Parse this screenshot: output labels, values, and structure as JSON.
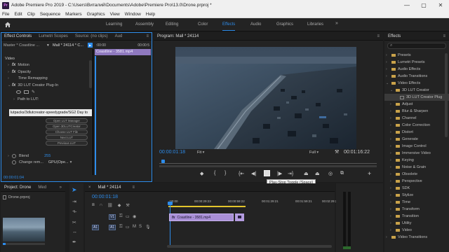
{
  "app": {
    "logo": "Pr",
    "title": "Adobe Premiere Pro 2019 - C:\\Users\\Виталий\\Documents\\Adobe\\Premiere Pro\\13.0\\Drone.prproj *",
    "minimize_glyph": "—",
    "maximize_glyph": "▢",
    "close_glyph": "✕"
  },
  "menu": [
    "File",
    "Edit",
    "Clip",
    "Sequence",
    "Markers",
    "Graphics",
    "View",
    "Window",
    "Help"
  ],
  "workspace": {
    "tabs": [
      "Learning",
      "Assembly",
      "Editing",
      "Color",
      "Effects",
      "Audio",
      "Graphics",
      "Libraries"
    ],
    "active": "Effects",
    "more": "»"
  },
  "left_panel": {
    "tabs": [
      "Effect Controls",
      "Lumetri Scopes",
      "Source: (no clips)",
      "Aud"
    ],
    "menu_glyph": "≡",
    "master_label": "Master * Coastline ...",
    "sequence_label": "Mall * 24114 * C...",
    "ruler_start": ":00:00",
    "ruler_end": "00:00:5",
    "clip_name": "Coastline - 3581.mp4",
    "video_header": "Video",
    "motion": "Motion",
    "opacity": "Opacity",
    "time_remapping": "Time Remapping",
    "plugin_name": "3D LUT Creator Plug-In",
    "path_label": "Path to LUT:",
    "path_value": "lutpacks/3dlutcreator-speedygrade/SG2 Day to",
    "buttons": [
      "Open LUT Manager",
      "Open 3DLUTCreator",
      "Choose LUT File",
      "Next LUT",
      "Previous LUT"
    ],
    "blend_label": "Blend",
    "blend_value": "255",
    "change_label": "Change rem...",
    "change_value": "GPU(Ope...",
    "timecode": "00:00:01:04"
  },
  "program": {
    "tab": "Program: Mall * 24114",
    "menu_glyph": "≡",
    "timecode": "00:00:01:18",
    "fit": "Fit",
    "quality": "Full",
    "duration": "00:01:16:22",
    "tooltip": "Play-Stop Toggle (Space)",
    "controls": {
      "marker": "◆",
      "in": "{",
      "out": "}",
      "go_in": "{⇤",
      "step_back": "◀|",
      "play": "▶",
      "step_fwd": "|▶",
      "go_out": "⇥}",
      "lift": "⏏",
      "extract": "⏏",
      "export_frame": "◎",
      "compare": "⧉",
      "add": "+"
    }
  },
  "effects_panel": {
    "title": "Effects",
    "menu_glyph": "≡",
    "search_placeholder": "",
    "search_icon": "⌕",
    "items": [
      {
        "label": "Presets",
        "type": "folder",
        "level": 0,
        "open": false
      },
      {
        "label": "Lumetri Presets",
        "type": "folder",
        "level": 0,
        "open": false
      },
      {
        "label": "Audio Effects",
        "type": "folder",
        "level": 0,
        "open": false
      },
      {
        "label": "Audio Transitions",
        "type": "folder",
        "level": 0,
        "open": false
      },
      {
        "label": "Video Effects",
        "type": "folder",
        "level": 0,
        "open": true
      },
      {
        "label": "3D LUT Creator",
        "type": "folder",
        "level": 1,
        "open": true
      },
      {
        "label": "3D LUT Creator Plug",
        "type": "effect",
        "level": 2,
        "open": false,
        "selected": true
      },
      {
        "label": "Adjust",
        "type": "folder",
        "level": 1,
        "open": false
      },
      {
        "label": "Blur & Sharpen",
        "type": "folder",
        "level": 1,
        "open": false
      },
      {
        "label": "Channel",
        "type": "folder",
        "level": 1,
        "open": false
      },
      {
        "label": "Color Correction",
        "type": "folder",
        "level": 1,
        "open": false
      },
      {
        "label": "Distort",
        "type": "folder",
        "level": 1,
        "open": false
      },
      {
        "label": "Generate",
        "type": "folder",
        "level": 1,
        "open": false
      },
      {
        "label": "Image Control",
        "type": "folder",
        "level": 1,
        "open": false
      },
      {
        "label": "Immersive Video",
        "type": "folder",
        "level": 1,
        "open": false
      },
      {
        "label": "Keying",
        "type": "folder",
        "level": 1,
        "open": false
      },
      {
        "label": "Noise & Grain",
        "type": "folder",
        "level": 1,
        "open": false
      },
      {
        "label": "Obsolete",
        "type": "folder",
        "level": 1,
        "open": false
      },
      {
        "label": "Perspective",
        "type": "folder",
        "level": 1,
        "open": false
      },
      {
        "label": "SDK",
        "type": "folder",
        "level": 1,
        "open": false
      },
      {
        "label": "Stylize",
        "type": "folder",
        "level": 1,
        "open": false
      },
      {
        "label": "Time",
        "type": "folder",
        "level": 1,
        "open": false
      },
      {
        "label": "Transform",
        "type": "folder",
        "level": 1,
        "open": false
      },
      {
        "label": "Transition",
        "type": "folder",
        "level": 1,
        "open": false
      },
      {
        "label": "Utility",
        "type": "folder",
        "level": 1,
        "open": false
      },
      {
        "label": "Video",
        "type": "folder",
        "level": 1,
        "open": false
      },
      {
        "label": "Video Transitions",
        "type": "folder",
        "level": 0,
        "open": false
      }
    ]
  },
  "project_panel": {
    "tabs": [
      "Project: Drone",
      "Med"
    ],
    "more": "»",
    "file": "Drone.prproj"
  },
  "timeline": {
    "tab": "Mall * 24114",
    "close_glyph": "×",
    "menu_glyph": "≡",
    "timecode": "00:00:01:18",
    "ruler": [
      ":00:00",
      "00:00:29:23",
      "00:00:59:22",
      "00:01:29:21",
      "00:01:59:21",
      "00:02:29:20"
    ],
    "tracks": [
      {
        "target": "",
        "name": "V1",
        "clip": "Coastline - 3581.mp4"
      },
      {
        "target": "A1",
        "name": "A1",
        "clip": ""
      }
    ]
  },
  "colors": {
    "accent": "#2d8ceb",
    "clip_video": "#a98fd6",
    "clip_header": "#b49ce0",
    "playhead": "#2d8ceb",
    "render_bar": "#e3c52b"
  }
}
